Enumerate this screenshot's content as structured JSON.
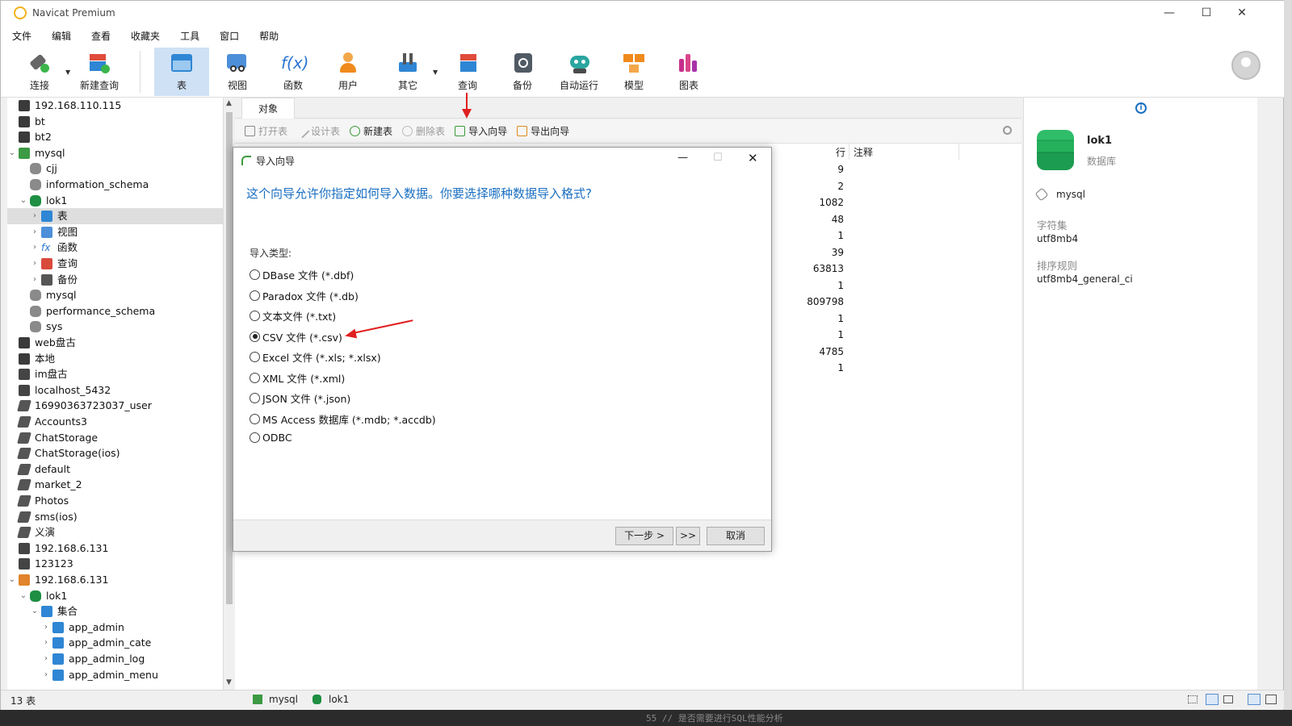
{
  "app_title": "Navicat Premium",
  "menu": [
    "文件",
    "编辑",
    "查看",
    "收藏夹",
    "工具",
    "窗口",
    "帮助"
  ],
  "toolbar": {
    "connect": "连接",
    "new_query": "新建查询",
    "table": "表",
    "view": "视图",
    "function": "函数",
    "user": "用户",
    "other": "其它",
    "query": "查询",
    "backup": "备份",
    "automation": "自动运行",
    "model": "模型",
    "chart": "图表"
  },
  "tree": {
    "items": [
      {
        "label": "192.168.110.115"
      },
      {
        "label": "bt"
      },
      {
        "label": "bt2"
      },
      {
        "label": "mysql"
      },
      {
        "label": "cjj"
      },
      {
        "label": "information_schema"
      },
      {
        "label": "lok1"
      },
      {
        "label": "表"
      },
      {
        "label": "视图"
      },
      {
        "label": "函数"
      },
      {
        "label": "查询"
      },
      {
        "label": "备份"
      },
      {
        "label": "mysql"
      },
      {
        "label": "performance_schema"
      },
      {
        "label": "sys"
      },
      {
        "label": "web盘古"
      },
      {
        "label": "本地"
      },
      {
        "label": "im盘古"
      },
      {
        "label": "localhost_5432"
      },
      {
        "label": "16990363723037_user"
      },
      {
        "label": "Accounts3"
      },
      {
        "label": "ChatStorage"
      },
      {
        "label": "ChatStorage(ios)"
      },
      {
        "label": "default"
      },
      {
        "label": "market_2"
      },
      {
        "label": "Photos"
      },
      {
        "label": "sms(ios)"
      },
      {
        "label": "义演"
      },
      {
        "label": "192.168.6.131"
      },
      {
        "label": "123123"
      },
      {
        "label": "192.168.6.131"
      },
      {
        "label": "lok1"
      },
      {
        "label": "集合"
      },
      {
        "label": "app_admin"
      },
      {
        "label": "app_admin_cate"
      },
      {
        "label": "app_admin_log"
      },
      {
        "label": "app_admin_menu"
      }
    ]
  },
  "object_tab": "对象",
  "objbar": {
    "open_table": "打开表",
    "design_table": "设计表",
    "new_table": "新建表",
    "delete_table": "删除表",
    "import_wizard": "导入向导",
    "export_wizard": "导出向导"
  },
  "columns": {
    "rows": "行",
    "comment": "注释"
  },
  "row_counts": [
    "9",
    "2",
    "1082",
    "48",
    "1",
    "39",
    "63813",
    "1",
    "809798",
    "1",
    "1",
    "4785",
    "1"
  ],
  "info": {
    "name": "lok1",
    "type": "数据库",
    "connection": "mysql",
    "charset_label": "字符集",
    "charset": "utf8mb4",
    "collation_label": "排序规则",
    "collation": "utf8mb4_general_ci"
  },
  "dialog": {
    "title": "导入向导",
    "question": "这个向导允许你指定如何导入数据。你要选择哪种数据导入格式?",
    "import_type_label": "导入类型:",
    "options": [
      {
        "label": "DBase 文件 (*.dbf)",
        "checked": false
      },
      {
        "label": "Paradox 文件 (*.db)",
        "checked": false
      },
      {
        "label": "文本文件 (*.txt)",
        "checked": false
      },
      {
        "label": "CSV 文件 (*.csv)",
        "checked": true
      },
      {
        "label": "Excel 文件 (*.xls; *.xlsx)",
        "checked": false
      },
      {
        "label": "XML 文件 (*.xml)",
        "checked": false
      },
      {
        "label": "JSON 文件 (*.json)",
        "checked": false
      },
      {
        "label": "MS Access 数据库 (*.mdb; *.accdb)",
        "checked": false
      },
      {
        "label": "ODBC",
        "checked": false
      }
    ],
    "next_button": "下一步 >",
    "skip_button": ">>",
    "cancel_button": "取消"
  },
  "status": {
    "count": "13 表",
    "connection": "mysql",
    "database": "lok1"
  },
  "bottom_code": "55    //  是否需要进行SQL性能分析",
  "colors": {
    "accent": "#1a6fc1",
    "selected_tool": "#cfe1f5",
    "arrow": "#e02020"
  }
}
